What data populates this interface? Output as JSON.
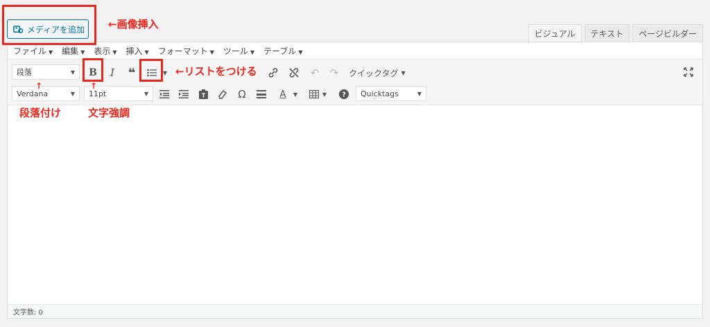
{
  "media_button": {
    "label": "メディアを追加"
  },
  "tabs": [
    {
      "label": "ビジュアル"
    },
    {
      "label": "テキスト"
    },
    {
      "label": "ページビルダー"
    }
  ],
  "menubar": [
    {
      "label": "ファイル"
    },
    {
      "label": "編集"
    },
    {
      "label": "表示"
    },
    {
      "label": "挿入"
    },
    {
      "label": "フォーマット"
    },
    {
      "label": "ツール"
    },
    {
      "label": "テーブル"
    }
  ],
  "toolbar": {
    "paragraph_select": "段落",
    "quicktag_label": "クイックタグ",
    "font_select": "Verdana",
    "size_select": "11pt",
    "quicktags_select": "Quicktags",
    "omega": "Ω"
  },
  "status": {
    "word_count": "文字数: 0"
  },
  "annotations": {
    "media": "←画像挿入",
    "list": "←リストをつける",
    "paragraph": "段落付け",
    "bold": "文字強調"
  }
}
